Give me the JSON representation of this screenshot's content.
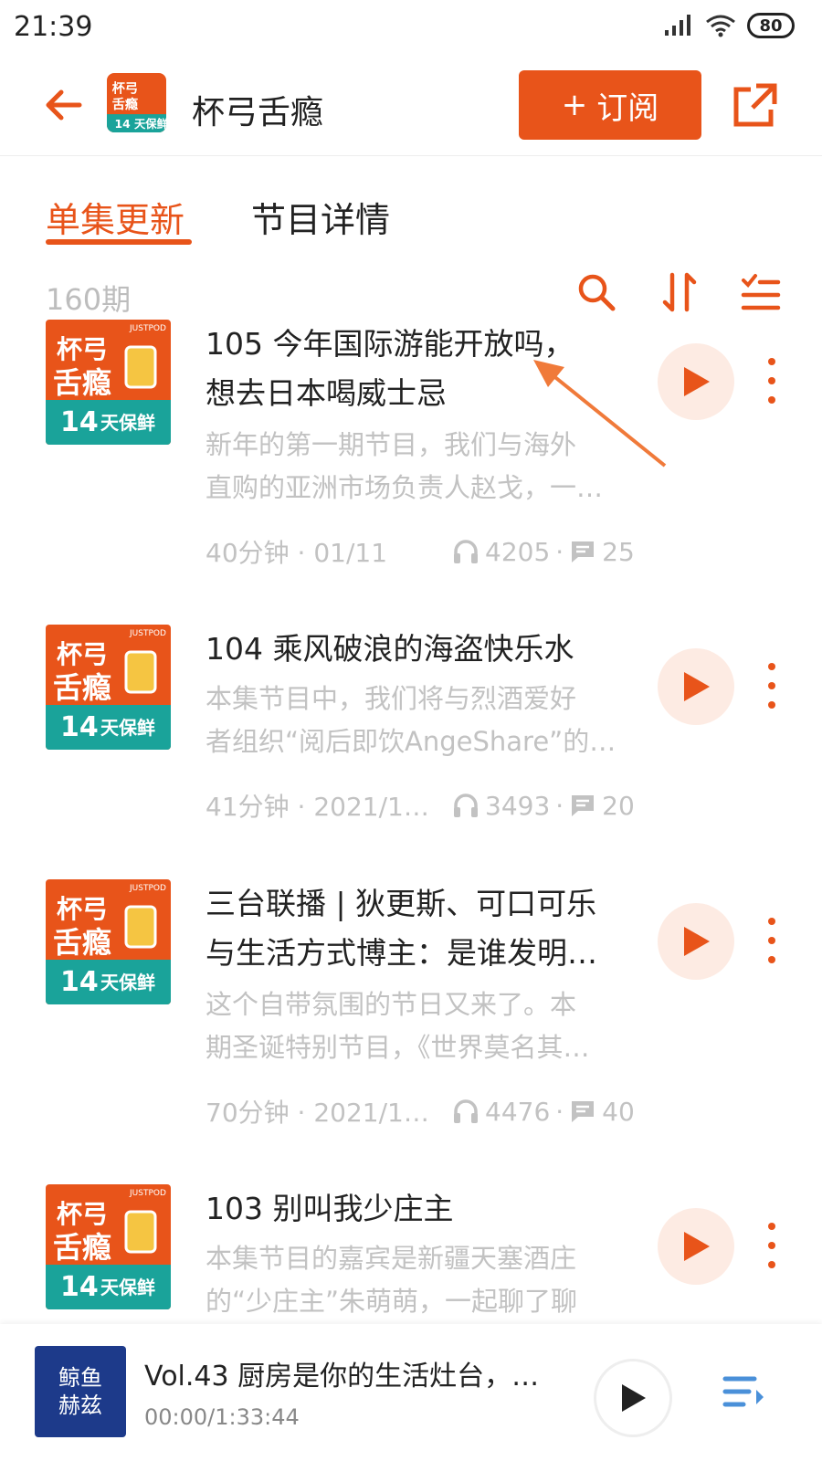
{
  "status": {
    "time": "21:39",
    "battery": "80"
  },
  "header": {
    "title": "杯弓舌瘾",
    "subscribe_label": "订阅",
    "subscribe_plus": "+"
  },
  "tabs": [
    {
      "label": "单集更新"
    },
    {
      "label": "节目详情"
    }
  ],
  "toolbar": {
    "count": "160期"
  },
  "cover_art": {
    "line1": "杯弓",
    "line2": "舌瘾",
    "badge_num": "14",
    "badge_text": "天保鲜",
    "brand": "JUSTPOD"
  },
  "episodes": [
    {
      "title_line1": "105 今年国际游能开放吗，",
      "title_line2": "想去日本喝威士忌",
      "desc_line1": "新年的第一期节目，我们与海外",
      "desc_line2": "直购的亚洲市场负责人赵戈，一…",
      "duration_date": "40分钟 · 01/11",
      "plays": "4205",
      "comments": "25"
    },
    {
      "title_line1": "104 乘风破浪的海盗快乐水",
      "desc_line1": "本集节目中，我们将与烈酒爱好",
      "desc_line2": "者组织“阅后即饮AngeShare”的…",
      "duration_date": "41分钟 · 2021/1…",
      "plays": "3493",
      "comments": "20"
    },
    {
      "title_line1": "三台联播 | 狄更斯、可口可乐",
      "title_line2": "与生活方式博主：是谁发明…",
      "desc_line1": "这个自带氛围的节日又来了。本",
      "desc_line2": "期圣诞特别节目，《世界莫名其…",
      "duration_date": "70分钟 · 2021/1…",
      "plays": "4476",
      "comments": "40"
    },
    {
      "title_line1": "103 别叫我少庄主",
      "desc_line1": "本集节目的嘉宾是新疆天塞酒庄",
      "desc_line2": "的“少庄主”朱萌萌，一起聊了聊"
    }
  ],
  "player": {
    "cover_line1": "鲸鱼",
    "cover_line2": "赫兹",
    "title": "Vol.43 厨房是你的生活灶台，…",
    "time": "00:00/1:33:44"
  },
  "colors": {
    "accent": "#e8541a",
    "play_bg": "#fdebe3",
    "muted": "#c2c2c2"
  }
}
